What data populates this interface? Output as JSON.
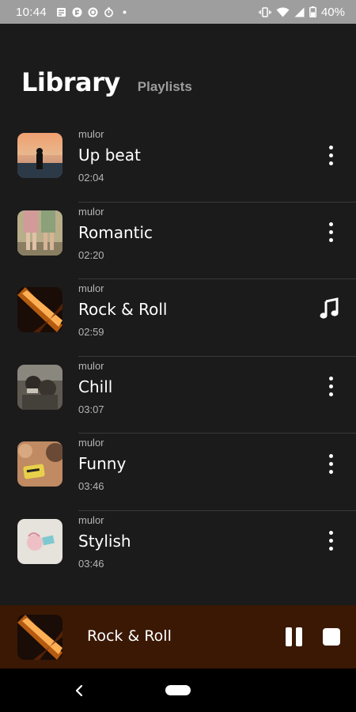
{
  "status_bar": {
    "time": "10:44",
    "left_icons": [
      "news-icon",
      "flipboard-icon",
      "pocket-casts-icon",
      "timer-icon",
      "dot-icon"
    ],
    "right_icons": [
      "vibrate-icon",
      "wifi-icon",
      "signal-icon",
      "battery-icon"
    ],
    "battery_percent": "40%"
  },
  "header": {
    "title": "Library",
    "tab_label": "Playlists"
  },
  "tracks": [
    {
      "artist": "mulor",
      "title": "Up beat",
      "duration": "02:04",
      "action_icon": "more-vert-icon"
    },
    {
      "artist": "mulor",
      "title": "Romantic",
      "duration": "02:20",
      "action_icon": "more-vert-icon"
    },
    {
      "artist": "mulor",
      "title": "Rock & Roll",
      "duration": "02:59",
      "action_icon": "music-note-icon"
    },
    {
      "artist": "mulor",
      "title": "Chill",
      "duration": "03:07",
      "action_icon": "more-vert-icon"
    },
    {
      "artist": "mulor",
      "title": "Funny",
      "duration": "03:46",
      "action_icon": "more-vert-icon"
    },
    {
      "artist": "mulor",
      "title": "Stylish",
      "duration": "03:46",
      "action_icon": "more-vert-icon"
    }
  ],
  "now_playing": {
    "title": "Rock & Roll",
    "controls": [
      "pause-icon",
      "stop-icon"
    ]
  },
  "nav_bar": {
    "icons": [
      "back-icon",
      "home-pill-icon"
    ]
  },
  "colors": {
    "background": "#1b1b1b",
    "player_background": "#3a1804",
    "status_bar": "#9e9e9e",
    "secondary_text": "#b4b4b4"
  }
}
